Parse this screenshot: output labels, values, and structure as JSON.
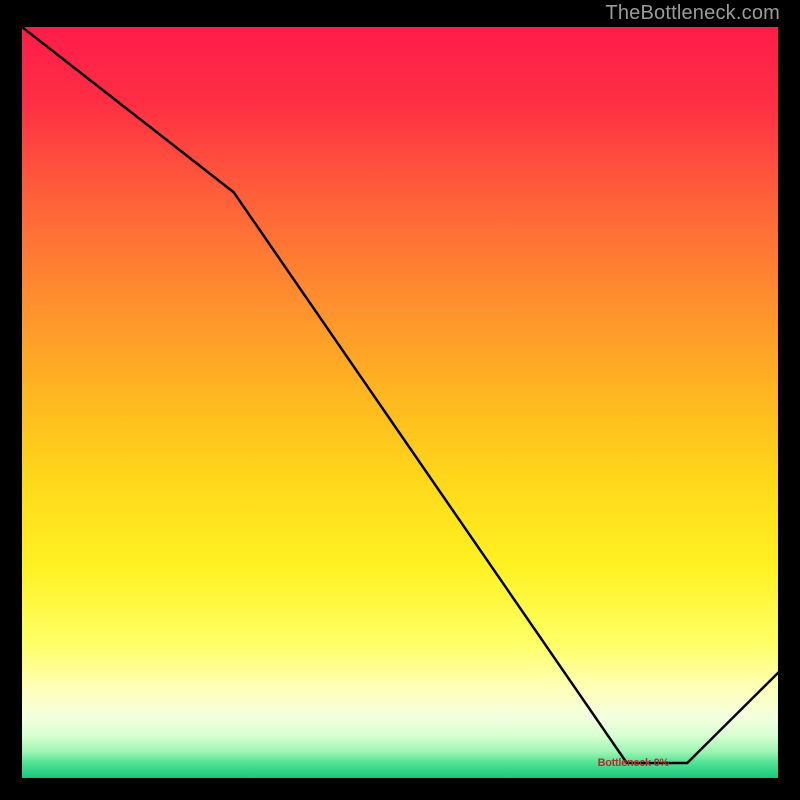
{
  "attribution": "TheBottleneck.com",
  "chart_data": {
    "type": "line",
    "title": "",
    "xlabel": "",
    "ylabel": "",
    "xlim": [
      0,
      100
    ],
    "ylim": [
      0,
      100
    ],
    "series": [
      {
        "name": "bottleneck-curve",
        "x": [
          0,
          28,
          80,
          88,
          100
        ],
        "values": [
          100,
          78,
          2,
          2,
          14
        ]
      }
    ],
    "annotations": [
      {
        "text_key": "bottom_annotation",
        "x": 81,
        "y": 2.5
      }
    ],
    "gradient_stops": [
      {
        "pct": 0,
        "color": "#ff1c49"
      },
      {
        "pct": 10,
        "color": "#ff2e44"
      },
      {
        "pct": 22,
        "color": "#ff5d3a"
      },
      {
        "pct": 35,
        "color": "#ff8a30"
      },
      {
        "pct": 48,
        "color": "#ffb321"
      },
      {
        "pct": 60,
        "color": "#ffd71a"
      },
      {
        "pct": 72,
        "color": "#fff223"
      },
      {
        "pct": 82,
        "color": "#ffff66"
      },
      {
        "pct": 88,
        "color": "#ffffb8"
      },
      {
        "pct": 92,
        "color": "#f3ffe0"
      },
      {
        "pct": 94.5,
        "color": "#d6ffd0"
      },
      {
        "pct": 96.5,
        "color": "#9df5b3"
      },
      {
        "pct": 98,
        "color": "#4fe294"
      },
      {
        "pct": 100,
        "color": "#18c97a"
      }
    ]
  },
  "labels": {
    "bottom_annotation": "Bottleneck 0%"
  }
}
